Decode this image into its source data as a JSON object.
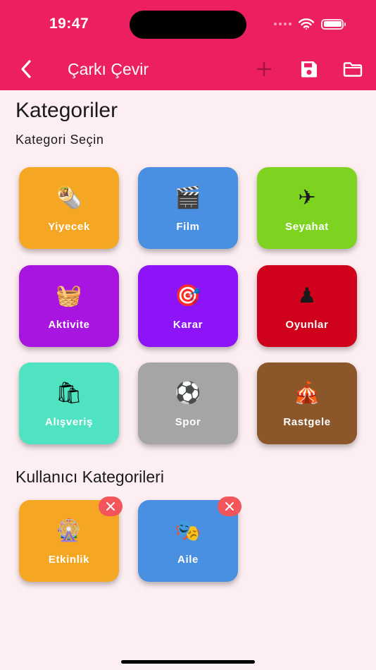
{
  "status_bar": {
    "time": "19:47"
  },
  "nav": {
    "title": "Çarkı Çevir",
    "back_icon": "chevron-left-icon",
    "actions": [
      "plus-icon",
      "save-icon",
      "folder-icon"
    ]
  },
  "colors": {
    "header": "#EC1F60",
    "background": "#FDEEF1",
    "delete_badge": "#F2555A"
  },
  "page": {
    "heading": "Kategoriler",
    "subheading": "Kategori Seçin",
    "user_heading": "Kullanıcı Kategorileri"
  },
  "categories": [
    {
      "label": "Yiyecek",
      "emoji": "🌯",
      "color": "#F5A623"
    },
    {
      "label": "Film",
      "emoji": "🎬",
      "color": "#4A90E2"
    },
    {
      "label": "Seyahat",
      "emoji": "✈",
      "color": "#7ED321"
    },
    {
      "label": "Aktivite",
      "emoji": "🧺",
      "color": "#A915E0"
    },
    {
      "label": "Karar",
      "emoji": "🎯",
      "color": "#8E14F8"
    },
    {
      "label": "Oyunlar",
      "emoji": "♟",
      "color": "#D0021B"
    },
    {
      "label": "Alışveriş",
      "emoji": "🛍",
      "color": "#50E3C2"
    },
    {
      "label": "Spor",
      "emoji": "⚽",
      "color": "#A5A5A5"
    },
    {
      "label": "Rastgele",
      "emoji": "🎪",
      "color": "#8B572A"
    }
  ],
  "user_categories": [
    {
      "label": "Etkinlik",
      "emoji": "🎡",
      "color": "#F5A623"
    },
    {
      "label": "Aile",
      "emoji": "🎭",
      "color": "#4A90E2"
    }
  ]
}
